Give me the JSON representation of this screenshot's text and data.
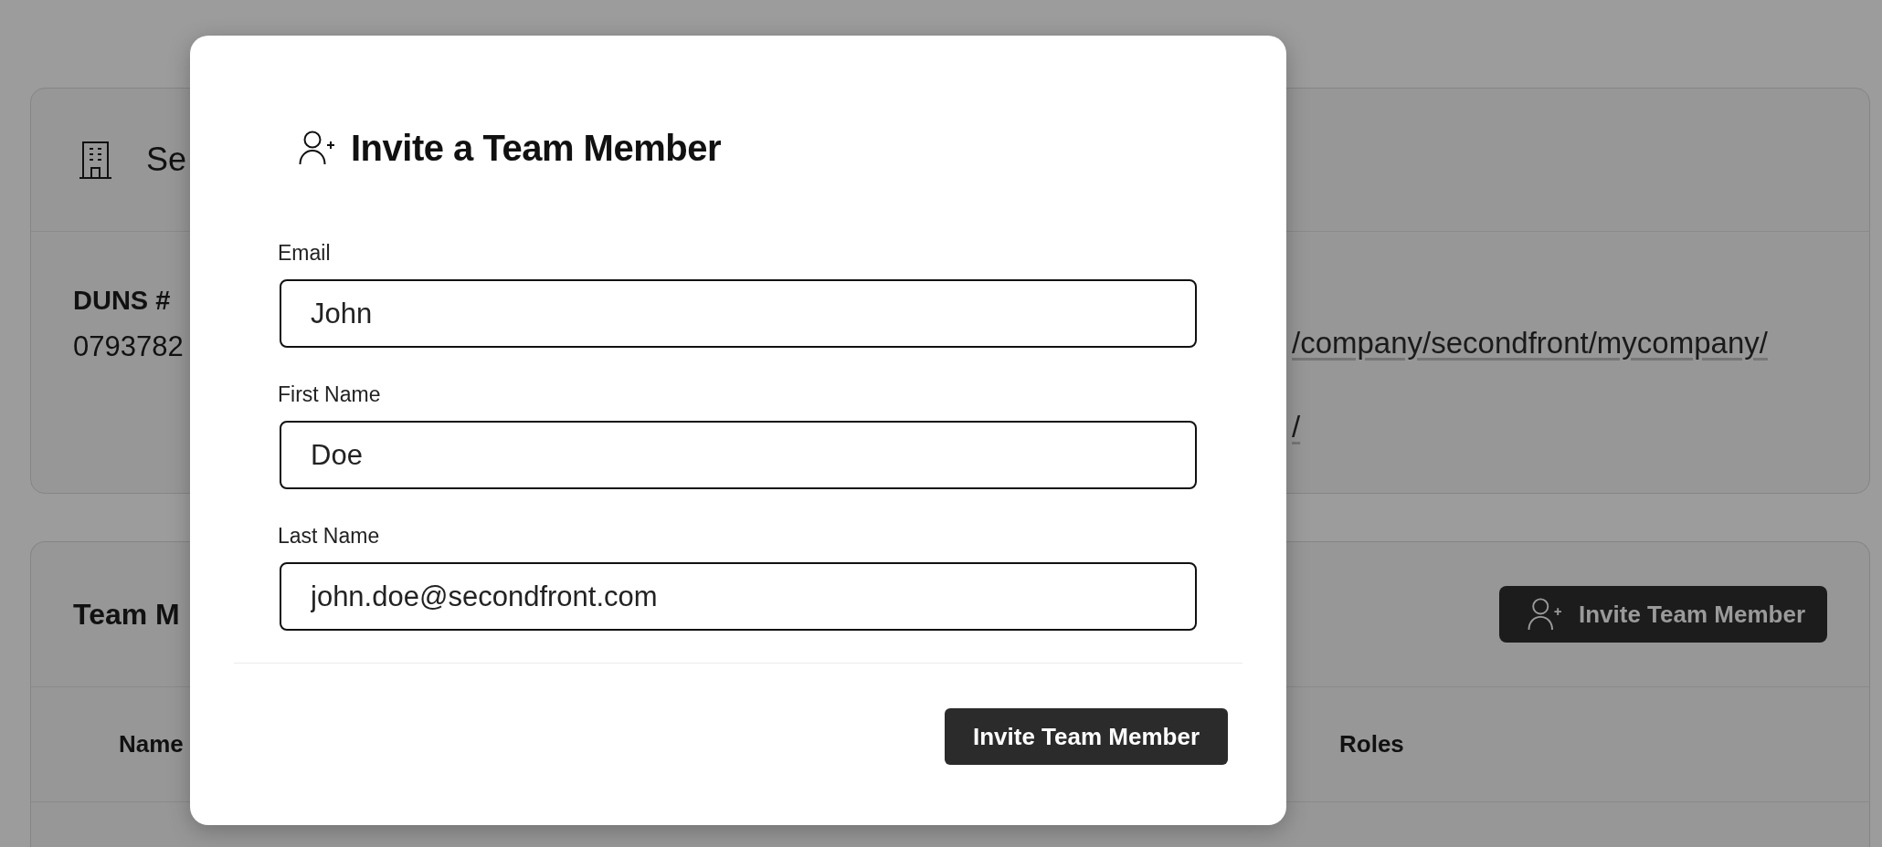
{
  "company_card": {
    "title": "Se",
    "duns_label": "DUNS #",
    "duns_value": "0793782",
    "links": [
      "/company/secondfront/mycompany/",
      "/"
    ]
  },
  "team_card": {
    "title": "Team M",
    "invite_button": "Invite Team Member",
    "columns": [
      "Name",
      "Roles"
    ]
  },
  "dialog": {
    "title": "Invite a Team Member",
    "fields": [
      {
        "label": "Email",
        "value": "John"
      },
      {
        "label": "First Name",
        "value": "Doe"
      },
      {
        "label": "Last Name",
        "value": "john.doe@secondfront.com"
      }
    ],
    "submit_button": "Invite Team Member"
  }
}
